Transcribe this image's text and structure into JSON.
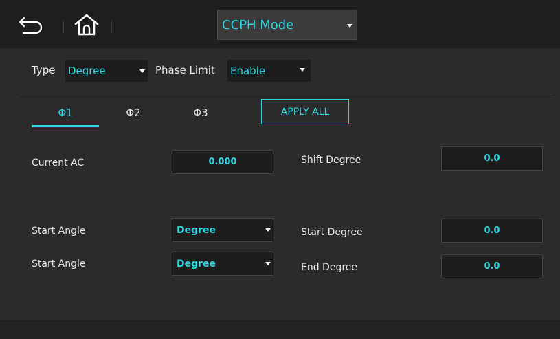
{
  "header": {
    "mode_select": {
      "value": "CCPH Mode"
    }
  },
  "type_row": {
    "type_label": "Type",
    "type_value": "Degree",
    "phase_limit_label": "Phase Limit",
    "phase_limit_value": "Enable"
  },
  "tabs": [
    {
      "label": "Φ1",
      "active": true
    },
    {
      "label": "Φ2",
      "active": false
    },
    {
      "label": "Φ3",
      "active": false
    }
  ],
  "apply_all_label": "APPLY ALL",
  "fields": {
    "current_ac_label": "Current AC",
    "current_ac_value": "0.000",
    "shift_degree_label": "Shift Degree",
    "shift_degree_value": "0.0",
    "start_angle_1_label": "Start Angle",
    "start_angle_1_value": "Degree",
    "start_degree_label": "Start Degree",
    "start_degree_value": "0.0",
    "start_angle_2_label": "Start Angle",
    "start_angle_2_value": "Degree",
    "end_degree_label": "End Degree",
    "end_degree_value": "0.0"
  },
  "colors": {
    "accent": "#2fd5e0",
    "background": "#2b2b2b",
    "topbar": "#1e1e1e",
    "field_bg": "#1d1d1d"
  },
  "icons": [
    "back-arrow-icon",
    "home-icon",
    "chevron-down-icon"
  ]
}
